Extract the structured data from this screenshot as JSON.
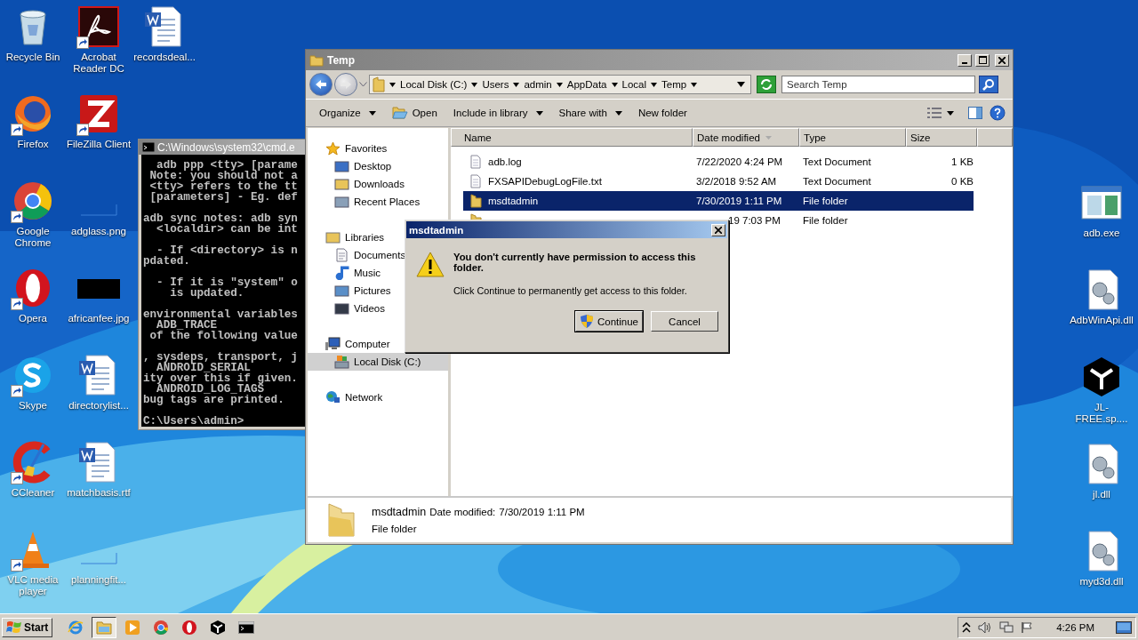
{
  "desktop": {
    "icons": [
      {
        "label": "Recycle Bin",
        "kind": "recycle",
        "shortcut": false
      },
      {
        "label": "Firefox",
        "kind": "firefox",
        "shortcut": true
      },
      {
        "label": "Google Chrome",
        "kind": "chrome",
        "shortcut": true
      },
      {
        "label": "Opera",
        "kind": "opera",
        "shortcut": true
      },
      {
        "label": "Skype",
        "kind": "skype",
        "shortcut": true
      },
      {
        "label": "CCleaner",
        "kind": "ccleaner",
        "shortcut": true
      },
      {
        "label": "VLC media player",
        "kind": "vlc",
        "shortcut": true
      },
      {
        "label": "Acrobat Reader DC",
        "kind": "acrobat",
        "shortcut": true
      },
      {
        "label": "FileZilla Client",
        "kind": "filezilla",
        "shortcut": true
      },
      {
        "label": "adglass.png",
        "kind": "blank",
        "shortcut": false
      },
      {
        "label": "africanfee.jpg",
        "kind": "black",
        "shortcut": false
      },
      {
        "label": "directorylist...",
        "kind": "word",
        "shortcut": false
      },
      {
        "label": "matchbasis.rtf",
        "kind": "word",
        "shortcut": false
      },
      {
        "label": "planningfit...",
        "kind": "blank",
        "shortcut": false
      },
      {
        "label": "recordsdeal...",
        "kind": "word",
        "shortcut": false
      }
    ],
    "right_icons": [
      {
        "label": "adb.exe",
        "kind": "exe",
        "shortcut": false
      },
      {
        "label": "AdbWinApi.dll",
        "kind": "dll",
        "shortcut": false
      },
      {
        "label": "JL-FREE.sp....",
        "kind": "cube",
        "shortcut": false
      },
      {
        "label": "jl.dll",
        "kind": "dll",
        "shortcut": false
      },
      {
        "label": "myd3d.dll",
        "kind": "dll",
        "shortcut": false
      }
    ]
  },
  "cmd_window": {
    "title": "C:\\Windows\\system32\\cmd.e",
    "blocks": [
      [
        "  adb ppp <tty> [parame",
        " Note: you should not a",
        " <tty> refers to the tt",
        " [parameters] - Eg. def"
      ],
      [
        "adb sync notes: adb syn",
        "  <localdir> can be int"
      ],
      [
        "  - If <directory> is n",
        "pdated."
      ],
      [
        "  - If it is \"system\" o",
        "    is updated."
      ],
      [
        "environmental variables",
        "  ADB_TRACE",
        " of the following value"
      ],
      [
        ", sysdeps, transport, j",
        "  ANDROID_SERIAL",
        "ity over this if given.",
        "  ANDROID_LOG_TAGS",
        "bug tags are printed."
      ],
      [
        "C:\\Users\\admin>"
      ]
    ]
  },
  "explorer": {
    "title": "Temp",
    "breadcrumb": [
      "Local Disk (C:)",
      "Users",
      "admin",
      "AppData",
      "Local",
      "Temp"
    ],
    "search": {
      "placeholder": "Search Temp"
    },
    "toolbar": [
      {
        "label": "Organize",
        "kind": "text",
        "dropdown": true
      },
      {
        "label": "Open",
        "kind": "open",
        "dropdown": false
      },
      {
        "label": "Include in library",
        "kind": "text",
        "dropdown": true
      },
      {
        "label": "Share with",
        "kind": "text",
        "dropdown": true
      },
      {
        "label": "New folder",
        "kind": "text",
        "dropdown": false
      }
    ],
    "nav": [
      {
        "label": "Favorites",
        "kind": "star",
        "selected": false,
        "children": [
          {
            "label": "Desktop",
            "kind": "desktop",
            "selected": false
          },
          {
            "label": "Downloads",
            "kind": "downloads",
            "selected": false
          },
          {
            "label": "Recent Places",
            "kind": "recent",
            "selected": false
          }
        ]
      },
      {
        "label": "Libraries",
        "kind": "libraries",
        "selected": false,
        "children": [
          {
            "label": "Documents",
            "kind": "documents",
            "selected": false
          },
          {
            "label": "Music",
            "kind": "music",
            "selected": false
          },
          {
            "label": "Pictures",
            "kind": "pictures",
            "selected": false
          },
          {
            "label": "Videos",
            "kind": "videos",
            "selected": false
          }
        ]
      },
      {
        "label": "Computer",
        "kind": "computer",
        "selected": false,
        "children": [
          {
            "label": "Local Disk (C:)",
            "kind": "disk",
            "selected": true
          }
        ]
      },
      {
        "label": "Network",
        "kind": "network",
        "selected": false
      }
    ],
    "columns": [
      {
        "label": "Name",
        "sorted": false
      },
      {
        "label": "Date modified",
        "sorted": true
      },
      {
        "label": "Type",
        "sorted": false
      },
      {
        "label": "Size",
        "sorted": false
      }
    ],
    "rows": [
      {
        "kind": "file",
        "name": "adb.log",
        "date": "7/22/2020 4:24 PM",
        "type": "Text Document",
        "size": "1 KB",
        "selected": false
      },
      {
        "kind": "file",
        "name": "FXSAPIDebugLogFile.txt",
        "date": "3/2/2018 9:52 AM",
        "type": "Text Document",
        "size": "0 KB",
        "selected": false
      },
      {
        "kind": "folder",
        "name": "msdtadmin",
        "date": "7/30/2019 1:11 PM",
        "type": "File folder",
        "selected": true
      },
      {
        "kind": "folder",
        "date": "19 7:03 PM",
        "type": "File folder",
        "selected": false
      }
    ],
    "details": {
      "name": "msdtadmin",
      "date_label": "Date modified:",
      "date": "7/30/2019 1:11 PM",
      "type": "File folder"
    }
  },
  "dialog": {
    "title": "msdtadmin",
    "message": "You don't currently have permission to access this folder.",
    "detail": "Click Continue to permanently get access to this folder.",
    "buttons": [
      {
        "label": "Continue",
        "default": true
      },
      {
        "label": "Cancel",
        "default": false
      }
    ]
  },
  "taskbar": {
    "start": "Start",
    "items": [
      {
        "kind": "ie",
        "active": false
      },
      {
        "kind": "explorer",
        "active": true
      },
      {
        "kind": "player",
        "active": false
      },
      {
        "kind": "chrome",
        "active": false
      },
      {
        "kind": "opera",
        "active": false
      },
      {
        "kind": "cube",
        "active": false
      },
      {
        "kind": "cmd",
        "active": false
      }
    ],
    "clock": "4:26 PM"
  }
}
